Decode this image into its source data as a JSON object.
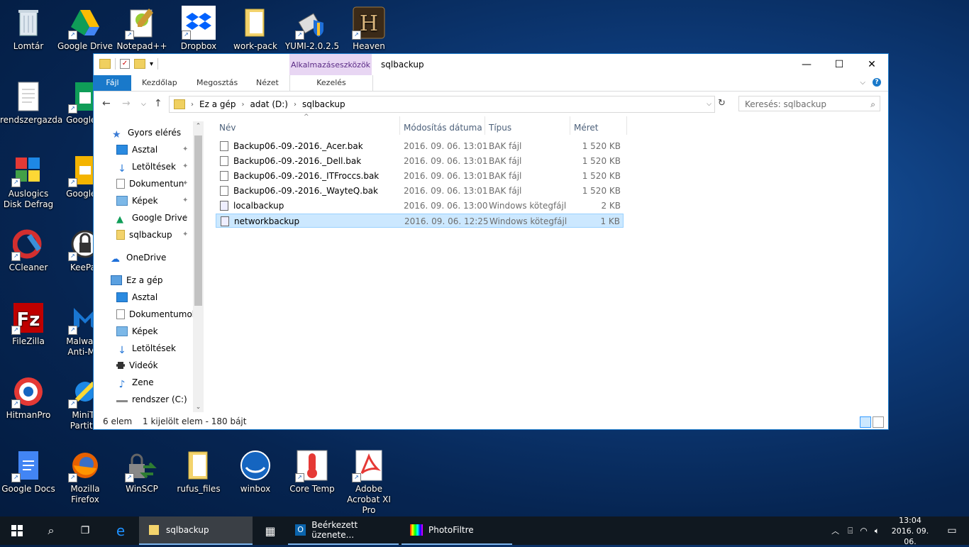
{
  "desktop": {
    "top_icons": [
      "Lomtár",
      "Google Drive",
      "Notepad++",
      "Dropbox",
      "work-pack",
      "YUMI-2.0.2.5",
      "Heaven"
    ],
    "left_col1": [
      "rendszergazda",
      "Auslogics Disk Defrag",
      "CCleaner",
      "FileZilla",
      "HitmanPro"
    ],
    "left_col2": [
      "Google S",
      "Google S",
      "KeePas",
      "Malwarel Anti-Mal",
      "MiniTo Partitio"
    ],
    "bottom_icons": [
      "Google Docs",
      "Mozilla Firefox",
      "WinSCP",
      "rufus_files",
      "winbox",
      "Core Temp",
      "Adobe Acrobat XI Pro"
    ]
  },
  "window": {
    "title": "sqlbackup",
    "context_group": "Alkalmazáseszközök",
    "tabs": {
      "file": "Fájl",
      "home": "Kezdőlap",
      "share": "Megosztás",
      "view": "Nézet",
      "manage": "Kezelés"
    },
    "address": {
      "crumbs": [
        "Ez a gép",
        "adat (D:)",
        "sqlbackup"
      ]
    },
    "search_placeholder": "Keresés: sqlbackup"
  },
  "nav": {
    "quick_access": "Gyors elérés",
    "quick_items": [
      "Asztal",
      "Letöltések",
      "Dokumentun",
      "Képek",
      "Google Drive",
      "sqlbackup"
    ],
    "onedrive": "OneDrive",
    "this_pc": "Ez a gép",
    "pc_items": [
      "Asztal",
      "Dokumentumok",
      "Képek",
      "Letöltések",
      "Videók",
      "Zene",
      "rendszer (C:)"
    ]
  },
  "columns": {
    "name": "Név",
    "date": "Módosítás dátuma",
    "type": "Típus",
    "size": "Méret"
  },
  "files": [
    {
      "name": "Backup06.-09.-2016._Acer.bak",
      "date": "2016. 09. 06. 13:01",
      "type": "BAK fájl",
      "size": "1 520 KB"
    },
    {
      "name": "Backup06.-09.-2016._Dell.bak",
      "date": "2016. 09. 06. 13:01",
      "type": "BAK fájl",
      "size": "1 520 KB"
    },
    {
      "name": "Backup06.-09.-2016._ITFroccs.bak",
      "date": "2016. 09. 06. 13:01",
      "type": "BAK fájl",
      "size": "1 520 KB"
    },
    {
      "name": "Backup06.-09.-2016._WayteQ.bak",
      "date": "2016. 09. 06. 13:01",
      "type": "BAK fájl",
      "size": "1 520 KB"
    },
    {
      "name": "localbackup",
      "date": "2016. 09. 06. 13:00",
      "type": "Windows kötegfájl",
      "size": "2 KB"
    },
    {
      "name": "networkbackup",
      "date": "2016. 09. 06. 12:25",
      "type": "Windows kötegfájl",
      "size": "1 KB"
    }
  ],
  "status": {
    "count": "6 elem",
    "selection": "1 kijelölt elem - 180 bájt"
  },
  "taskbar": {
    "explorer": "sqlbackup",
    "outlook": "Beérkezett üzenete...",
    "photofiltre": "PhotoFiltre",
    "time": "13:04",
    "date": "2016. 09. 06."
  }
}
